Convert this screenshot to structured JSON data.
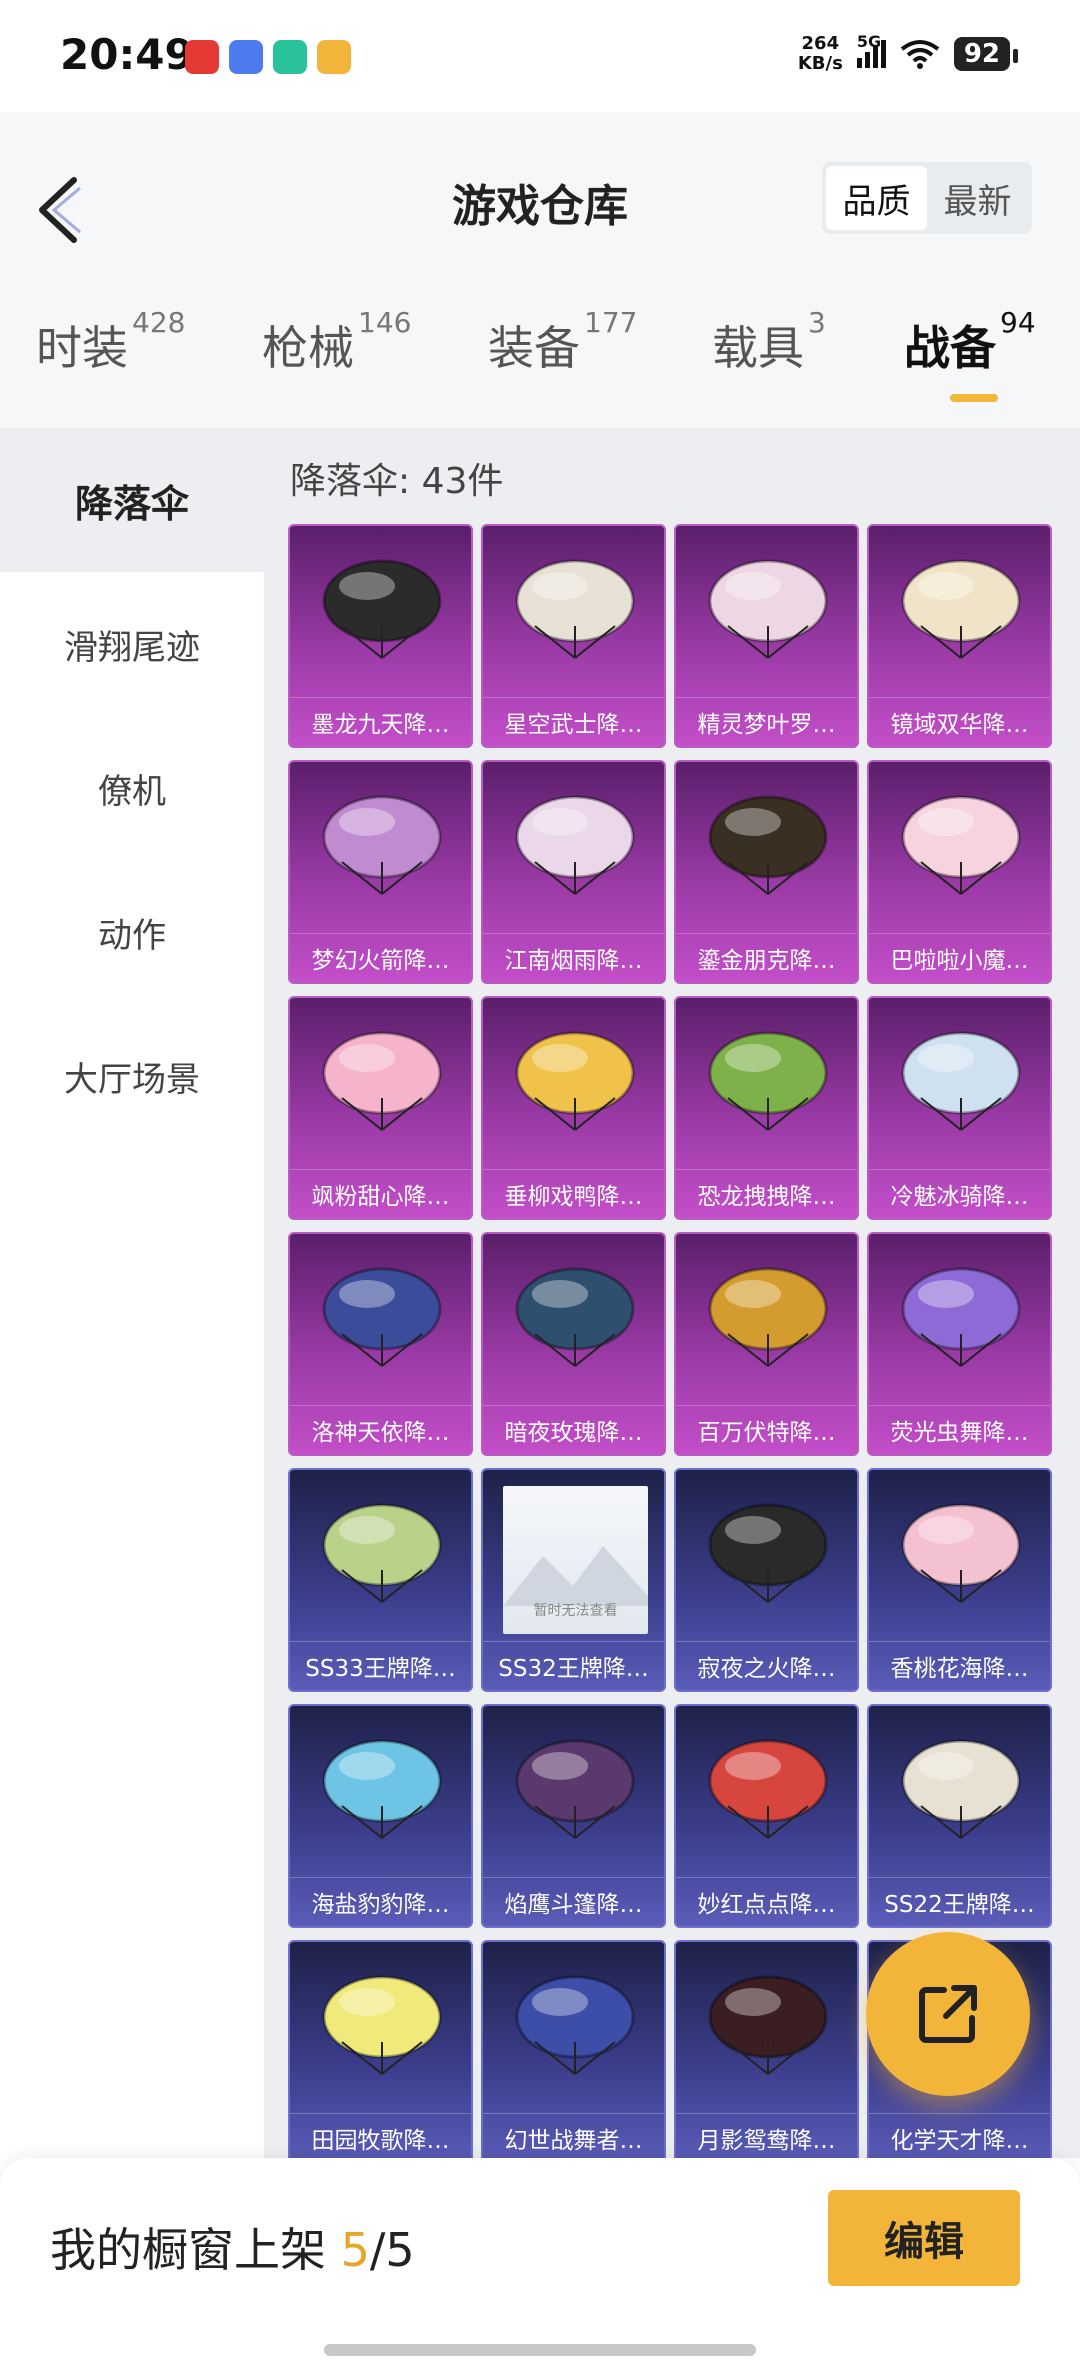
{
  "status_bar": {
    "time": "20:49",
    "network_speed_value": "264",
    "network_speed_unit": "KB/s",
    "network_type": "5G",
    "battery": "92",
    "app_icon_colors": [
      "#e53935",
      "#4f7bf0",
      "#29c29a",
      "#f2b53a"
    ]
  },
  "header": {
    "title": "游戏仓库",
    "sort": [
      "品质",
      "最新"
    ],
    "sort_selected": "品质"
  },
  "tabs": [
    {
      "label": "时装",
      "count": "428"
    },
    {
      "label": "枪械",
      "count": "146"
    },
    {
      "label": "装备",
      "count": "177"
    },
    {
      "label": "载具",
      "count": "3"
    },
    {
      "label": "战备",
      "count": "94"
    }
  ],
  "active_tab": "战备",
  "sidebar": {
    "items": [
      "降落伞",
      "滑翔尾迹",
      "僚机",
      "动作",
      "大厅场景"
    ],
    "active": "降落伞"
  },
  "content": {
    "count_label": "降落伞: 43件",
    "placeholder_text": "暂时无法查看",
    "items": [
      {
        "name": "墨龙九天降…",
        "rarity": "purple",
        "color": "#2b2b2b"
      },
      {
        "name": "星空武士降…",
        "rarity": "purple",
        "color": "#e8e2d6"
      },
      {
        "name": "精灵梦叶罗…",
        "rarity": "purple",
        "color": "#efd6e4"
      },
      {
        "name": "镜域双华降…",
        "rarity": "purple",
        "color": "#f1e3c8"
      },
      {
        "name": "梦幻火箭降…",
        "rarity": "purple",
        "color": "#c08bd1"
      },
      {
        "name": "江南烟雨降…",
        "rarity": "purple",
        "color": "#ebd7ea"
      },
      {
        "name": "鎏金朋克降…",
        "rarity": "purple",
        "color": "#3a2f23"
      },
      {
        "name": "巴啦啦小魔…",
        "rarity": "purple",
        "color": "#f6d3de"
      },
      {
        "name": "飒粉甜心降…",
        "rarity": "purple",
        "color": "#f5b4cb"
      },
      {
        "name": "垂柳戏鸭降…",
        "rarity": "purple",
        "color": "#f0c24a"
      },
      {
        "name": "恐龙拽拽降…",
        "rarity": "purple",
        "color": "#7fb14a"
      },
      {
        "name": "冷魅冰骑降…",
        "rarity": "purple",
        "color": "#cfe0f1"
      },
      {
        "name": "洛神天依降…",
        "rarity": "purple",
        "color": "#3b4d9a"
      },
      {
        "name": "暗夜玫瑰降…",
        "rarity": "purple",
        "color": "#2f4f6e"
      },
      {
        "name": "百万伏特降…",
        "rarity": "purple",
        "color": "#d49b2f"
      },
      {
        "name": "荧光虫舞降…",
        "rarity": "purple",
        "color": "#8e6ad6"
      },
      {
        "name": "SS33王牌降…",
        "rarity": "blue",
        "color": "#b9d28a"
      },
      {
        "name": "SS32王牌降…",
        "rarity": "blue",
        "color": "placeholder"
      },
      {
        "name": "寂夜之火降…",
        "rarity": "blue",
        "color": "#2a2a2a"
      },
      {
        "name": "香桃花海降…",
        "rarity": "blue",
        "color": "#f4c1d1"
      },
      {
        "name": "海盐豹豹降…",
        "rarity": "blue",
        "color": "#6ec4e4"
      },
      {
        "name": "焰鹰斗篷降…",
        "rarity": "blue",
        "color": "#5a3a6e"
      },
      {
        "name": "妙红点点降…",
        "rarity": "blue",
        "color": "#d6463f"
      },
      {
        "name": "SS22王牌降…",
        "rarity": "blue",
        "color": "#e6e1d2"
      },
      {
        "name": "田园牧歌降…",
        "rarity": "blue",
        "color": "#f0ea7a"
      },
      {
        "name": "幻世战舞者…",
        "rarity": "blue",
        "color": "#3d4ea8"
      },
      {
        "name": "月影鸳鸯降…",
        "rarity": "blue",
        "color": "#3a1e22"
      },
      {
        "name": "化学天才降…",
        "rarity": "blue",
        "color": "#6a6fd0"
      }
    ]
  },
  "bottom_bar": {
    "text_prefix": "我的橱窗上架",
    "current": "5",
    "separator": "/",
    "total": "5",
    "edit_label": "编辑"
  },
  "colors": {
    "accent": "#f2b53a",
    "purple_card": "#9a3aa6",
    "blue_card": "#3d3f8f"
  }
}
